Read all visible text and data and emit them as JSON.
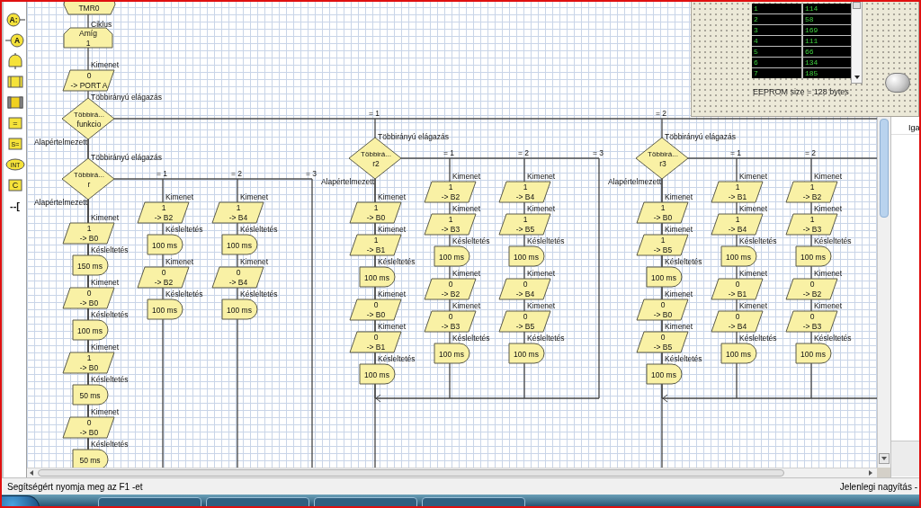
{
  "toolbar": [
    {
      "kind": "input",
      "glyph": "A:"
    },
    {
      "kind": "output",
      "glyph": "A"
    },
    {
      "kind": "delay"
    },
    {
      "kind": "macro"
    },
    {
      "kind": "component"
    },
    {
      "kind": "calculation",
      "glyph": "="
    },
    {
      "kind": "string",
      "glyph": "S="
    },
    {
      "kind": "interrupt",
      "glyph": "INT"
    },
    {
      "kind": "code",
      "glyph": "C"
    },
    {
      "kind": "comment",
      "glyph": "--["
    }
  ],
  "flowchart": {
    "items": [
      {
        "kind": "event",
        "value": "TMR0"
      },
      {
        "kind": "loop",
        "caption": "Ciklus",
        "title": "Amíg",
        "condition": "1"
      },
      {
        "kind": "output",
        "caption": "Kimenet",
        "value": "0",
        "target": "-> PORT A"
      },
      {
        "kind": "switch",
        "caption": "Többirányú elágazás",
        "title": "Többirá...",
        "variable": "funkcio",
        "default_label": "Alapértelmezett",
        "cut_off": true,
        "default": [
          {
            "kind": "switch",
            "caption": "Többirányú elágazás",
            "title": "Többirá...",
            "variable": "r",
            "default_label": "Alapértelmezett",
            "cut_off": false,
            "default": [
              {
                "kind": "output",
                "caption": "Kimenet",
                "value": "1",
                "target": "-> B0"
              },
              {
                "kind": "delay",
                "caption": "Késleltetés",
                "value": "150 ms"
              },
              {
                "kind": "output",
                "caption": "Kimenet",
                "value": "0",
                "target": "-> B0"
              },
              {
                "kind": "delay",
                "caption": "Késleltetés",
                "value": "100 ms"
              },
              {
                "kind": "output",
                "caption": "Kimenet",
                "value": "1",
                "target": "-> B0"
              },
              {
                "kind": "delay",
                "caption": "Késleltetés",
                "value": "50 ms"
              },
              {
                "kind": "output",
                "caption": "Kimenet",
                "value": "0",
                "target": "-> B0"
              },
              {
                "kind": "delay",
                "caption": "Késleltetés",
                "value": "50 ms"
              }
            ],
            "cases": [
              {
                "label": "= 1",
                "items": [
                  {
                    "kind": "output",
                    "caption": "Kimenet",
                    "value": "1",
                    "target": "-> B2"
                  },
                  {
                    "kind": "delay",
                    "caption": "Késleltetés",
                    "value": "100 ms"
                  },
                  {
                    "kind": "output",
                    "caption": "Kimenet",
                    "value": "0",
                    "target": "-> B2"
                  },
                  {
                    "kind": "delay",
                    "caption": "Késleltetés",
                    "value": "100 ms"
                  }
                ]
              },
              {
                "label": "= 2",
                "items": [
                  {
                    "kind": "output",
                    "caption": "Kimenet",
                    "value": "1",
                    "target": "-> B4"
                  },
                  {
                    "kind": "delay",
                    "caption": "Késleltetés",
                    "value": "100 ms"
                  },
                  {
                    "kind": "output",
                    "caption": "Kimenet",
                    "value": "0",
                    "target": "-> B4"
                  },
                  {
                    "kind": "delay",
                    "caption": "Késleltetés",
                    "value": "100 ms"
                  }
                ]
              },
              {
                "label": "= 3"
              }
            ]
          }
        ],
        "cases": [
          {
            "label": "= 1",
            "items": [
              {
                "kind": "switch",
                "caption": "Többirányú elágazás",
                "title": "Többirá...",
                "variable": "r2",
                "default_label": "Alapértelmezett",
                "cut_off": false,
                "default": [
                  {
                    "kind": "output",
                    "caption": "Kimenet",
                    "value": "1",
                    "target": "-> B0"
                  },
                  {
                    "kind": "output",
                    "caption": "Kimenet",
                    "value": "1",
                    "target": "-> B1"
                  },
                  {
                    "kind": "delay",
                    "caption": "Késleltetés",
                    "value": "100 ms"
                  },
                  {
                    "kind": "output",
                    "caption": "Kimenet",
                    "value": "0",
                    "target": "-> B0"
                  },
                  {
                    "kind": "output",
                    "caption": "Kimenet",
                    "value": "0",
                    "target": "-> B1"
                  },
                  {
                    "kind": "delay",
                    "caption": "Késleltetés",
                    "value": "100 ms"
                  }
                ],
                "cases": [
                  {
                    "label": "= 1",
                    "items": [
                      {
                        "kind": "output",
                        "caption": "Kimenet",
                        "value": "1",
                        "target": "-> B2"
                      },
                      {
                        "kind": "output",
                        "caption": "Kimenet",
                        "value": "1",
                        "target": "-> B3"
                      },
                      {
                        "kind": "delay",
                        "caption": "Késleltetés",
                        "value": "100 ms"
                      },
                      {
                        "kind": "output",
                        "caption": "Kimenet",
                        "value": "0",
                        "target": "-> B2"
                      },
                      {
                        "kind": "output",
                        "caption": "Kimenet",
                        "value": "0",
                        "target": "-> B3"
                      },
                      {
                        "kind": "delay",
                        "caption": "Késleltetés",
                        "value": "100 ms"
                      }
                    ]
                  },
                  {
                    "label": "= 2",
                    "items": [
                      {
                        "kind": "output",
                        "caption": "Kimenet",
                        "value": "1",
                        "target": "-> B4"
                      },
                      {
                        "kind": "output",
                        "caption": "Kimenet",
                        "value": "1",
                        "target": "-> B5"
                      },
                      {
                        "kind": "delay",
                        "caption": "Késleltetés",
                        "value": "100 ms"
                      },
                      {
                        "kind": "output",
                        "caption": "Kimenet",
                        "value": "0",
                        "target": "-> B4"
                      },
                      {
                        "kind": "output",
                        "caption": "Kimenet",
                        "value": "0",
                        "target": "-> B5"
                      },
                      {
                        "kind": "delay",
                        "caption": "Késleltetés",
                        "value": "100 ms"
                      }
                    ]
                  },
                  {
                    "label": "= 3"
                  }
                ]
              }
            ]
          },
          {
            "label": "= 2",
            "items": [
              {
                "kind": "switch",
                "caption": "Többirányú elágazás",
                "title": "Többirá...",
                "variable": "r3",
                "default_label": "Alapértelmezett",
                "cut_off": true,
                "default": [
                  {
                    "kind": "output",
                    "caption": "Kimenet",
                    "value": "1",
                    "target": "-> B0"
                  },
                  {
                    "kind": "output",
                    "caption": "Kimenet",
                    "value": "1",
                    "target": "-> B5"
                  },
                  {
                    "kind": "delay",
                    "caption": "Késleltetés",
                    "value": "100 ms"
                  },
                  {
                    "kind": "output",
                    "caption": "Kimenet",
                    "value": "0",
                    "target": "-> B0"
                  },
                  {
                    "kind": "output",
                    "caption": "Kimenet",
                    "value": "0",
                    "target": "-> B5"
                  },
                  {
                    "kind": "delay",
                    "caption": "Késleltetés",
                    "value": "100 ms"
                  }
                ],
                "cases": [
                  {
                    "label": "= 1",
                    "items": [
                      {
                        "kind": "output",
                        "caption": "Kimenet",
                        "value": "1",
                        "target": "-> B1"
                      },
                      {
                        "kind": "output",
                        "caption": "Kimenet",
                        "value": "1",
                        "target": "-> B4"
                      },
                      {
                        "kind": "delay",
                        "caption": "Késleltetés",
                        "value": "100 ms"
                      },
                      {
                        "kind": "output",
                        "caption": "Kimenet",
                        "value": "0",
                        "target": "-> B1"
                      },
                      {
                        "kind": "output",
                        "caption": "Kimenet",
                        "value": "0",
                        "target": "-> B4"
                      },
                      {
                        "kind": "delay",
                        "caption": "Késleltetés",
                        "value": "100 ms"
                      }
                    ]
                  },
                  {
                    "label": "= 2",
                    "items": [
                      {
                        "kind": "output",
                        "caption": "Kimenet",
                        "value": "1",
                        "target": "-> B2"
                      },
                      {
                        "kind": "output",
                        "caption": "Kimenet",
                        "value": "1",
                        "target": "-> B3"
                      },
                      {
                        "kind": "delay",
                        "caption": "Késleltetés",
                        "value": "100 ms"
                      },
                      {
                        "kind": "output",
                        "caption": "Kimenet",
                        "value": "0",
                        "target": "-> B2"
                      },
                      {
                        "kind": "output",
                        "caption": "Kimenet",
                        "value": "0",
                        "target": "-> B3"
                      },
                      {
                        "kind": "delay",
                        "caption": "Késleltetés",
                        "value": "100 ms"
                      }
                    ]
                  }
                ]
              }
            ]
          }
        ]
      }
    ]
  },
  "eeprom": {
    "rows": [
      {
        "address": "1",
        "value": "114"
      },
      {
        "address": "2",
        "value": "58"
      },
      {
        "address": "3",
        "value": "169"
      },
      {
        "address": "4",
        "value": "111"
      },
      {
        "address": "5",
        "value": "66"
      },
      {
        "address": "6",
        "value": "134"
      },
      {
        "address": "7",
        "value": "185"
      }
    ],
    "size_label": "EEPROM size = 128 bytes"
  },
  "side_panel": {
    "header": "Iga"
  },
  "status_bar": {
    "left": "Segítségért nyomja meg az F1 -et",
    "right": "Jelenlegi nagyítás -"
  }
}
